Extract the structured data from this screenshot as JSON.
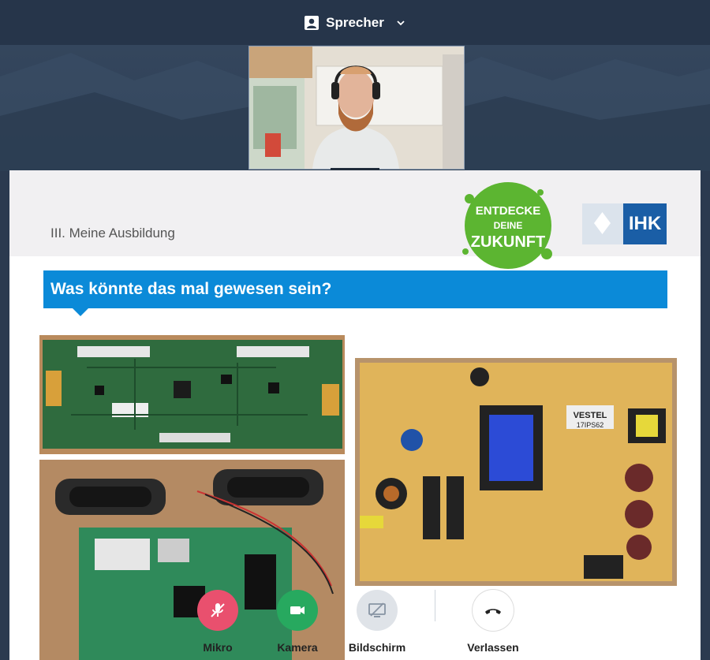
{
  "topbar": {
    "view_label": "Sprecher"
  },
  "slide": {
    "section_title": "III. Meine Ausbildung",
    "logo_entdecke": {
      "line1": "ENTDECKE",
      "line2": "DEINE",
      "line3": "ZUKUNFT"
    },
    "logo_ihk": "IHK",
    "banner": "Was könnte das mal gewesen sein?",
    "board_label_vestel": "VESTEL",
    "board_label_model": "17IPS62"
  },
  "controls": {
    "mic_label": "Mikro",
    "camera_label": "Kamera",
    "screen_label": "Bildschirm",
    "leave_label": "Verlassen"
  },
  "colors": {
    "topbar": "#26354a",
    "banner": "#0b8ad8",
    "mic": "#e9506e",
    "camera": "#27a95f",
    "ihk_blue": "#1a5ea6",
    "entdecke_green": "#5cb531"
  },
  "icons": [
    "person-icon",
    "chevron-down-icon",
    "mic-off-icon",
    "camera-icon",
    "screen-share-off-icon",
    "hang-up-icon"
  ]
}
